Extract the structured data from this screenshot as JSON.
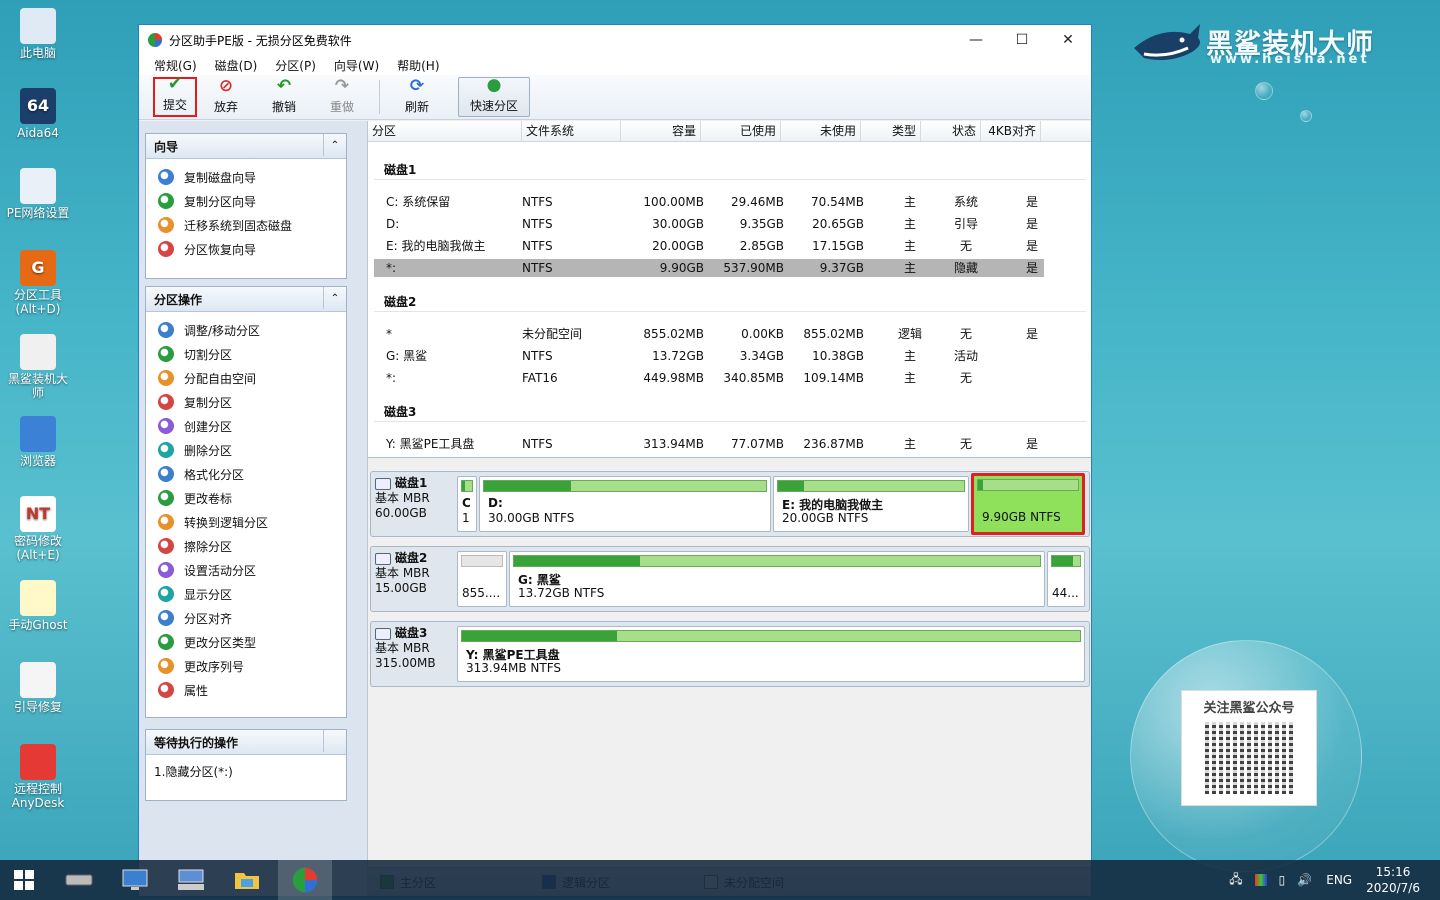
{
  "desktop": {
    "icons": [
      {
        "label": "此电脑",
        "icon": "computer-icon"
      },
      {
        "label": "Aida64",
        "icon": "aida64-icon",
        "glyph": "64"
      },
      {
        "label": "PE网络设置",
        "icon": "network-icon"
      },
      {
        "label": "分区工具\n(Alt+D)",
        "icon": "partition-tool-icon",
        "glyph": "G"
      },
      {
        "label": "黑鲨装机大\n师",
        "icon": "shark-icon"
      },
      {
        "label": "浏览器",
        "icon": "browser-icon"
      },
      {
        "label": "密码修改\n(Alt+E)",
        "icon": "password-icon",
        "glyph": "NT"
      },
      {
        "label": "手动Ghost",
        "icon": "ghost-icon"
      },
      {
        "label": "引导修复",
        "icon": "boot-repair-icon"
      },
      {
        "label": "远程控制\nAnyDesk",
        "icon": "anydesk-icon"
      }
    ],
    "brand_cn": "黑鲨装机大师",
    "brand_url": "www.heisha.net",
    "qr_title": "关注黑鲨公众号"
  },
  "window": {
    "title": "分区助手PE版 - 无损分区免费软件",
    "menu": [
      "常规(G)",
      "磁盘(D)",
      "分区(P)",
      "向导(W)",
      "帮助(H)"
    ],
    "toolbar": {
      "commit": "提交",
      "discard": "放弃",
      "undo": "撤销",
      "redo": "重做",
      "refresh": "刷新",
      "quick_partition": "快速分区"
    }
  },
  "sidebar": {
    "wizard_title": "向导",
    "wizard_items": [
      "复制磁盘向导",
      "复制分区向导",
      "迁移系统到固态磁盘",
      "分区恢复向导"
    ],
    "ops_title": "分区操作",
    "ops_items": [
      "调整/移动分区",
      "切割分区",
      "分配自由空间",
      "复制分区",
      "创建分区",
      "删除分区",
      "格式化分区",
      "更改卷标",
      "转换到逻辑分区",
      "擦除分区",
      "设置活动分区",
      "显示分区",
      "分区对齐",
      "更改分区类型",
      "更改序列号",
      "属性"
    ],
    "pending_title": "等待执行的操作",
    "pending_items": [
      "1.隐藏分区(*:)"
    ]
  },
  "table": {
    "headers": [
      "分区",
      "文件系统",
      "容量",
      "已使用",
      "未使用",
      "类型",
      "状态",
      "4KB对齐"
    ],
    "disks": [
      {
        "name": "磁盘1",
        "rows": [
          {
            "part": "C: 系统保留",
            "fs": "NTFS",
            "cap": "100.00MB",
            "used": "29.46MB",
            "free": "70.54MB",
            "type": "主",
            "status": "系统",
            "align": "是"
          },
          {
            "part": "D:",
            "fs": "NTFS",
            "cap": "30.00GB",
            "used": "9.35GB",
            "free": "20.65GB",
            "type": "主",
            "status": "引导",
            "align": "是"
          },
          {
            "part": "E: 我的电脑我做主",
            "fs": "NTFS",
            "cap": "20.00GB",
            "used": "2.85GB",
            "free": "17.15GB",
            "type": "主",
            "status": "无",
            "align": "是"
          },
          {
            "part": "*:",
            "fs": "NTFS",
            "cap": "9.90GB",
            "used": "537.90MB",
            "free": "9.37GB",
            "type": "主",
            "status": "隐藏",
            "align": "是",
            "selected": true
          }
        ]
      },
      {
        "name": "磁盘2",
        "rows": [
          {
            "part": "*",
            "fs": "未分配空间",
            "cap": "855.02MB",
            "used": "0.00KB",
            "free": "855.02MB",
            "type": "逻辑",
            "status": "无",
            "align": "是"
          },
          {
            "part": "G: 黑鲨",
            "fs": "NTFS",
            "cap": "13.72GB",
            "used": "3.34GB",
            "free": "10.38GB",
            "type": "主",
            "status": "活动",
            "align": ""
          },
          {
            "part": "*:",
            "fs": "FAT16",
            "cap": "449.98MB",
            "used": "340.85MB",
            "free": "109.14MB",
            "type": "主",
            "status": "无",
            "align": ""
          }
        ]
      },
      {
        "name": "磁盘3",
        "rows": [
          {
            "part": "Y: 黑鲨PE工具盘",
            "fs": "NTFS",
            "cap": "313.94MB",
            "used": "77.07MB",
            "free": "236.87MB",
            "type": "主",
            "status": "无",
            "align": "是"
          }
        ]
      }
    ]
  },
  "disk_maps": [
    {
      "name": "磁盘1",
      "kind": "基本 MBR",
      "size": "60.00GB",
      "parts": [
        {
          "label": "C",
          "sub": "1",
          "used": 0.3
        },
        {
          "label": "D:",
          "sub": "30.00GB NTFS",
          "used": 0.31
        },
        {
          "label": "E: 我的电脑我做主",
          "sub": "20.00GB NTFS",
          "used": 0.14
        },
        {
          "label": "",
          "sub": "9.90GB NTFS",
          "used": 0.05,
          "selected": true
        }
      ]
    },
    {
      "name": "磁盘2",
      "kind": "基本 MBR",
      "size": "15.00GB",
      "parts": [
        {
          "label": "",
          "sub": "855....",
          "used": 0,
          "unallocated": true
        },
        {
          "label": "G: 黑鲨",
          "sub": "13.72GB NTFS",
          "used": 0.24
        },
        {
          "label": "",
          "sub": "44...",
          "used": 0.75
        }
      ]
    },
    {
      "name": "磁盘3",
      "kind": "基本 MBR",
      "size": "315.00MB",
      "parts": [
        {
          "label": "Y: 黑鲨PE工具盘",
          "sub": "313.94MB NTFS",
          "used": 0.25
        }
      ]
    }
  ],
  "legend": [
    "主分区",
    "逻辑分区",
    "未分配空间"
  ],
  "taskbar": {
    "lang": "ENG",
    "time": "15:16",
    "date": "2020/7/6"
  },
  "colors": {
    "primary": "#39a339",
    "primary_light": "#a6de8a",
    "selected": "#8fe05a",
    "highlight": "#e21b1b"
  }
}
